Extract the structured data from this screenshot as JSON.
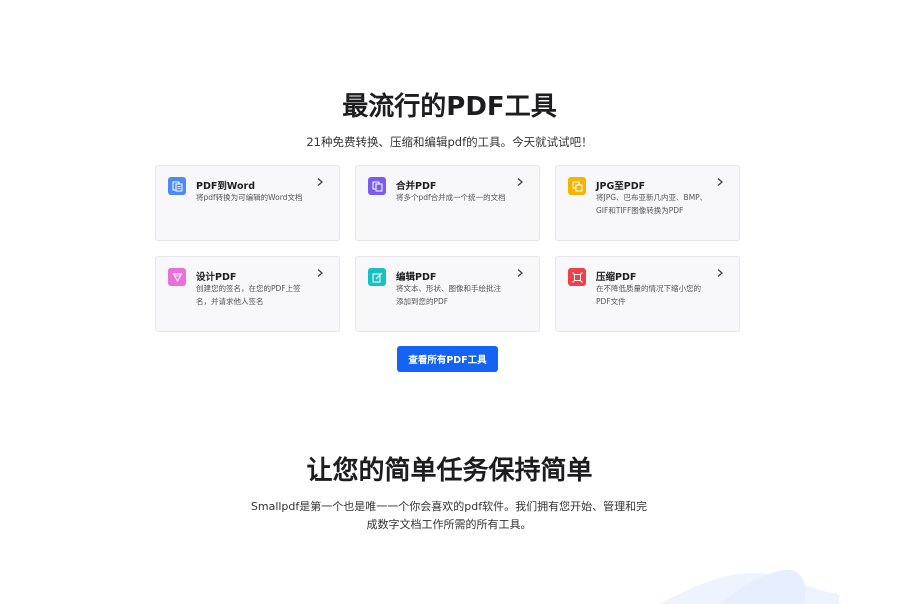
{
  "header": {
    "title": "最流行的PDF工具",
    "subtitle": "21种免费转换、压缩和编辑pdf的工具。今天就试试吧！"
  },
  "tools": [
    {
      "title": "PDF到Word",
      "description": "将pdf转换为可编辑的Word文档",
      "icon": "pdf-to-word-icon",
      "color": "#4c8bf5"
    },
    {
      "title": "合并PDF",
      "description": "将多个pdf合并成一个统一的文档",
      "icon": "merge-pdf-icon",
      "color": "#7b5cf0"
    },
    {
      "title": "JPG至PDF",
      "description": "将JPG、巴布亚新几内亚、BMP、GIF和TIFF图像转换为PDF",
      "icon": "jpg-to-pdf-icon",
      "color": "#f5b400"
    },
    {
      "title": "设计PDF",
      "description": "创建您的签名，在您的PDF上签名，并请求他人签名",
      "icon": "sign-pdf-icon",
      "color": "#e96fd9"
    },
    {
      "title": "编辑PDF",
      "description": "将文本、形状、图像和手绘批注添加到您的PDF",
      "icon": "edit-pdf-icon",
      "color": "#14c2c2"
    },
    {
      "title": "压缩PDF",
      "description": "在不降低质量的情况下缩小您的PDF文件",
      "icon": "compress-pdf-icon",
      "color": "#f23d4a"
    }
  ],
  "cta": {
    "label": "查看所有PDF工具",
    "color": "#1463f5"
  },
  "section2": {
    "title": "让您的简单任务保持简单",
    "description": "Smallpdf是第一个也是唯一一个你会喜欢的pdf软件。我们拥有您开始、管理和完成数字文档工作所需的所有工具。"
  }
}
